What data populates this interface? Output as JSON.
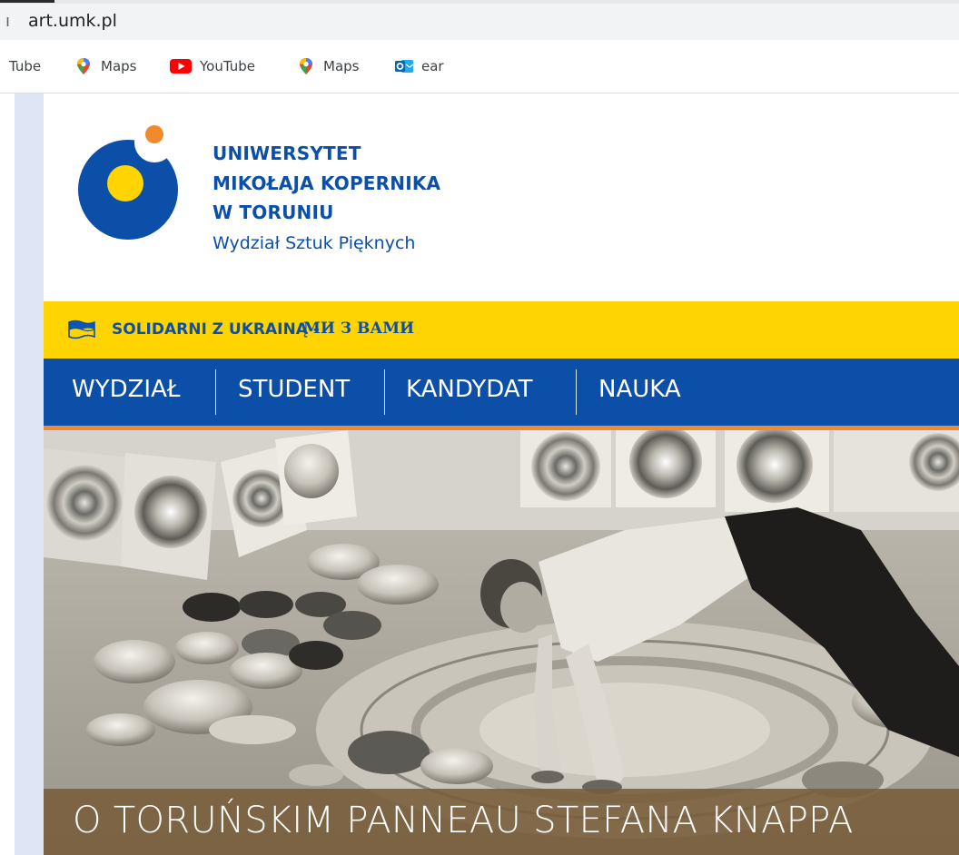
{
  "browser": {
    "url_prefix": "ı",
    "url": "art.umk.pl"
  },
  "bookmarks": [
    {
      "label": "Tube",
      "icon": "youtube-partial"
    },
    {
      "label": "Maps",
      "icon": "maps-pin-icon"
    },
    {
      "label": "YouTube",
      "icon": "youtube-icon"
    },
    {
      "label": "Maps",
      "icon": "maps-pin-icon"
    },
    {
      "label": "ear",
      "icon": "outlook-icon"
    }
  ],
  "header": {
    "uni_line1": "UNIWERSYTET",
    "uni_line2": "MIKOŁAJA KOPERNIKA",
    "uni_line3": "W TORUNIU",
    "faculty": "Wydział Sztuk Pięknych"
  },
  "banner": {
    "text_pl": "SOLIDARNI Z UKRAINĄ -",
    "text_ua": "МИ З ВАМИ",
    "flag_icon": "ukraine-flag-icon"
  },
  "nav": {
    "items": [
      "WYDZIAŁ",
      "STUDENT",
      "KANDYDAT",
      "NAUKA"
    ]
  },
  "hero": {
    "caption": "O TORUŃSKIM PANNEAU STEFANA KNAPPA",
    "image": "black-and-white-photo-artist-working-on-panneau"
  },
  "colors": {
    "brand_blue": "#0b4fa8",
    "banner_yellow": "#ffd400",
    "accent_orange": "#f08a2c",
    "caption_band": "#785c3a"
  }
}
